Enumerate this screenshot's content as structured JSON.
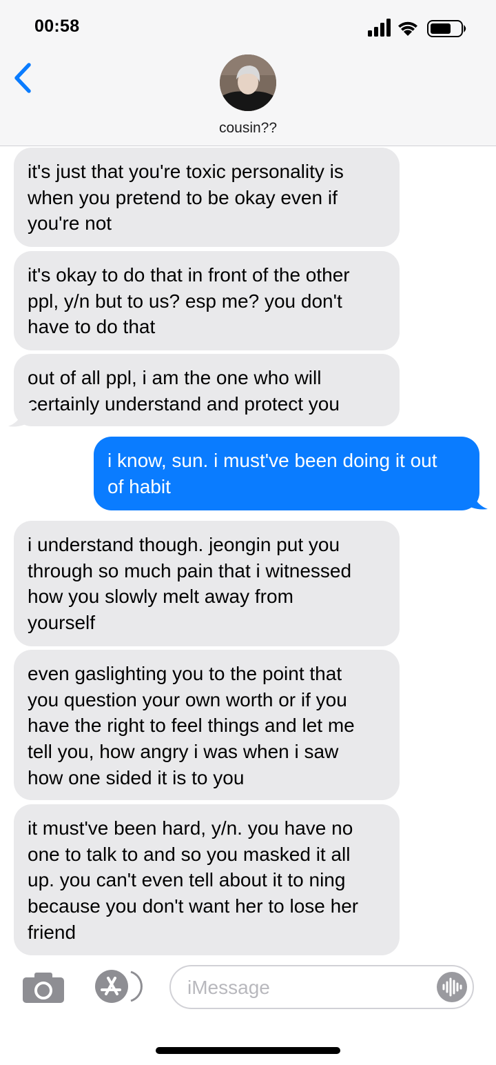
{
  "status_bar": {
    "time": "00:58"
  },
  "contact": {
    "name": "cousin??"
  },
  "messages": [
    {
      "from": "them",
      "lines": [
        "it's just that you're toxic personality is",
        "when you pretend to be okay even if",
        "you're not"
      ]
    },
    {
      "from": "them",
      "lines": [
        "it's okay to do that in front of the other",
        "ppl, y/n but to us? esp me? you don't",
        "have to do that"
      ]
    },
    {
      "from": "them",
      "lines": [
        "out of all ppl, i am the one who will",
        "certainly understand and protect you"
      ]
    },
    {
      "from": "me",
      "lines": [
        "i know, sun. i must've been doing it out",
        "of habit"
      ]
    },
    {
      "from": "them",
      "lines": [
        "i understand though. jeongin put you",
        "through so much pain that i witnessed",
        "how you slowly melt away from",
        "yourself"
      ]
    },
    {
      "from": "them",
      "lines": [
        "even gaslighting you to the point that",
        "you question your own worth or if you",
        "have the right to feel things and let me",
        "tell you, how angry i was when i saw",
        "how one sided it is to you"
      ]
    },
    {
      "from": "them",
      "lines": [
        "it must've been hard, y/n. you have no",
        "one to talk to and so you masked it all",
        "up. you can't even tell about it to ning",
        "because you don't want her to lose her",
        "friend"
      ]
    }
  ],
  "composer": {
    "placeholder": "iMessage"
  },
  "icons": {
    "back": "chevron-left-icon",
    "camera": "camera-icon",
    "appstore": "app-store-icon",
    "audio": "waveform-icon",
    "signal": "signal-icon",
    "wifi": "wifi-icon",
    "battery": "battery-icon"
  },
  "colors": {
    "accent": "#0a7cff",
    "incoming_bubble": "#e9e9eb",
    "header_bg": "#f6f6f7"
  }
}
